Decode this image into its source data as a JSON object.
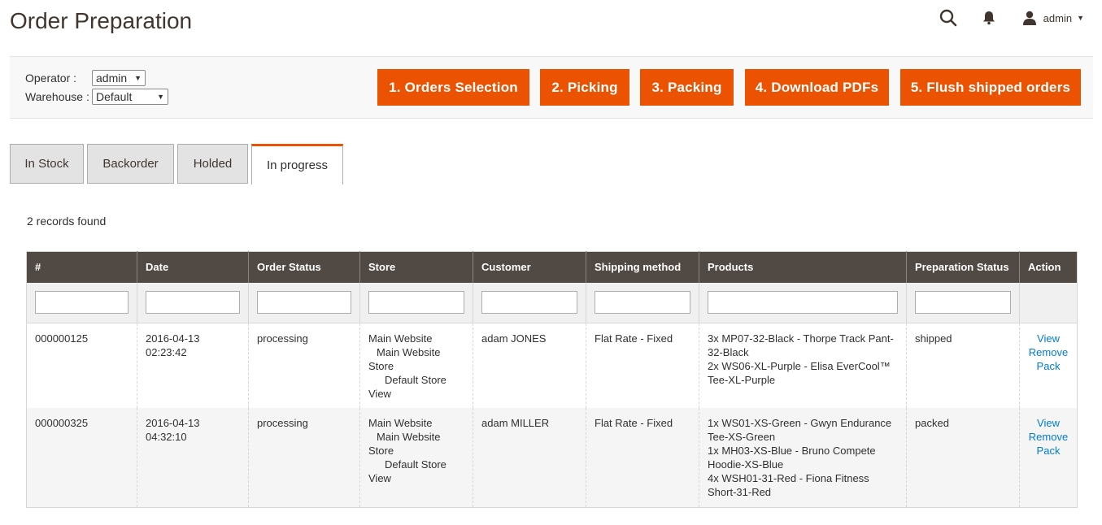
{
  "header": {
    "title": "Order Preparation",
    "user": "admin",
    "icons": {
      "search": "search-icon",
      "notifications": "bell-icon",
      "user": "user-icon"
    }
  },
  "toolbar": {
    "operator_label": "Operator :",
    "operator_value": "admin",
    "warehouse_label": "Warehouse :",
    "warehouse_value": "Default",
    "steps": [
      "1. Orders Selection",
      "2. Picking",
      "3. Packing",
      "4. Download PDFs",
      "5. Flush shipped orders"
    ]
  },
  "tabs": [
    "In Stock",
    "Backorder",
    "Holded",
    "In progress"
  ],
  "active_tab": "In progress",
  "records_found": "2 records found",
  "grid": {
    "columns": [
      "#",
      "Date",
      "Order Status",
      "Store",
      "Customer",
      "Shipping method",
      "Products",
      "Preparation Status",
      "Action"
    ],
    "rows": [
      {
        "id": "000000125",
        "date_line1": "2016-04-13",
        "date_line2": "02:23:42",
        "status": "processing",
        "store": [
          "Main Website",
          "Main Website",
          "Store",
          "Default Store",
          "View"
        ],
        "customer": "adam JONES",
        "shipping": "Flat Rate - Fixed",
        "products": [
          "3x MP07-32-Black - Thorpe Track Pant-",
          "32-Black",
          "2x WS06-XL-Purple - Elisa EverCool™",
          "Tee-XL-Purple"
        ],
        "prep_status": "shipped",
        "actions": [
          "View",
          "Remove",
          "Pack"
        ]
      },
      {
        "id": "000000325",
        "date_line1": "2016-04-13",
        "date_line2": "04:32:10",
        "status": "processing",
        "store": [
          "Main Website",
          "Main Website",
          "Store",
          "Default Store",
          "View"
        ],
        "customer": "adam MILLER",
        "shipping": "Flat Rate - Fixed",
        "products": [
          "1x WS01-XS-Green - Gwyn Endurance",
          "Tee-XS-Green",
          "1x MH03-XS-Blue - Bruno Compete",
          "Hoodie-XS-Blue",
          "4x WSH01-31-Red - Fiona Fitness",
          "Short-31-Red"
        ],
        "prep_status": "packed",
        "actions": [
          "View",
          "Remove",
          "Pack"
        ]
      }
    ]
  },
  "colors": {
    "accent": "#eb5202",
    "header_bg": "#514943",
    "link": "#007bdb"
  }
}
